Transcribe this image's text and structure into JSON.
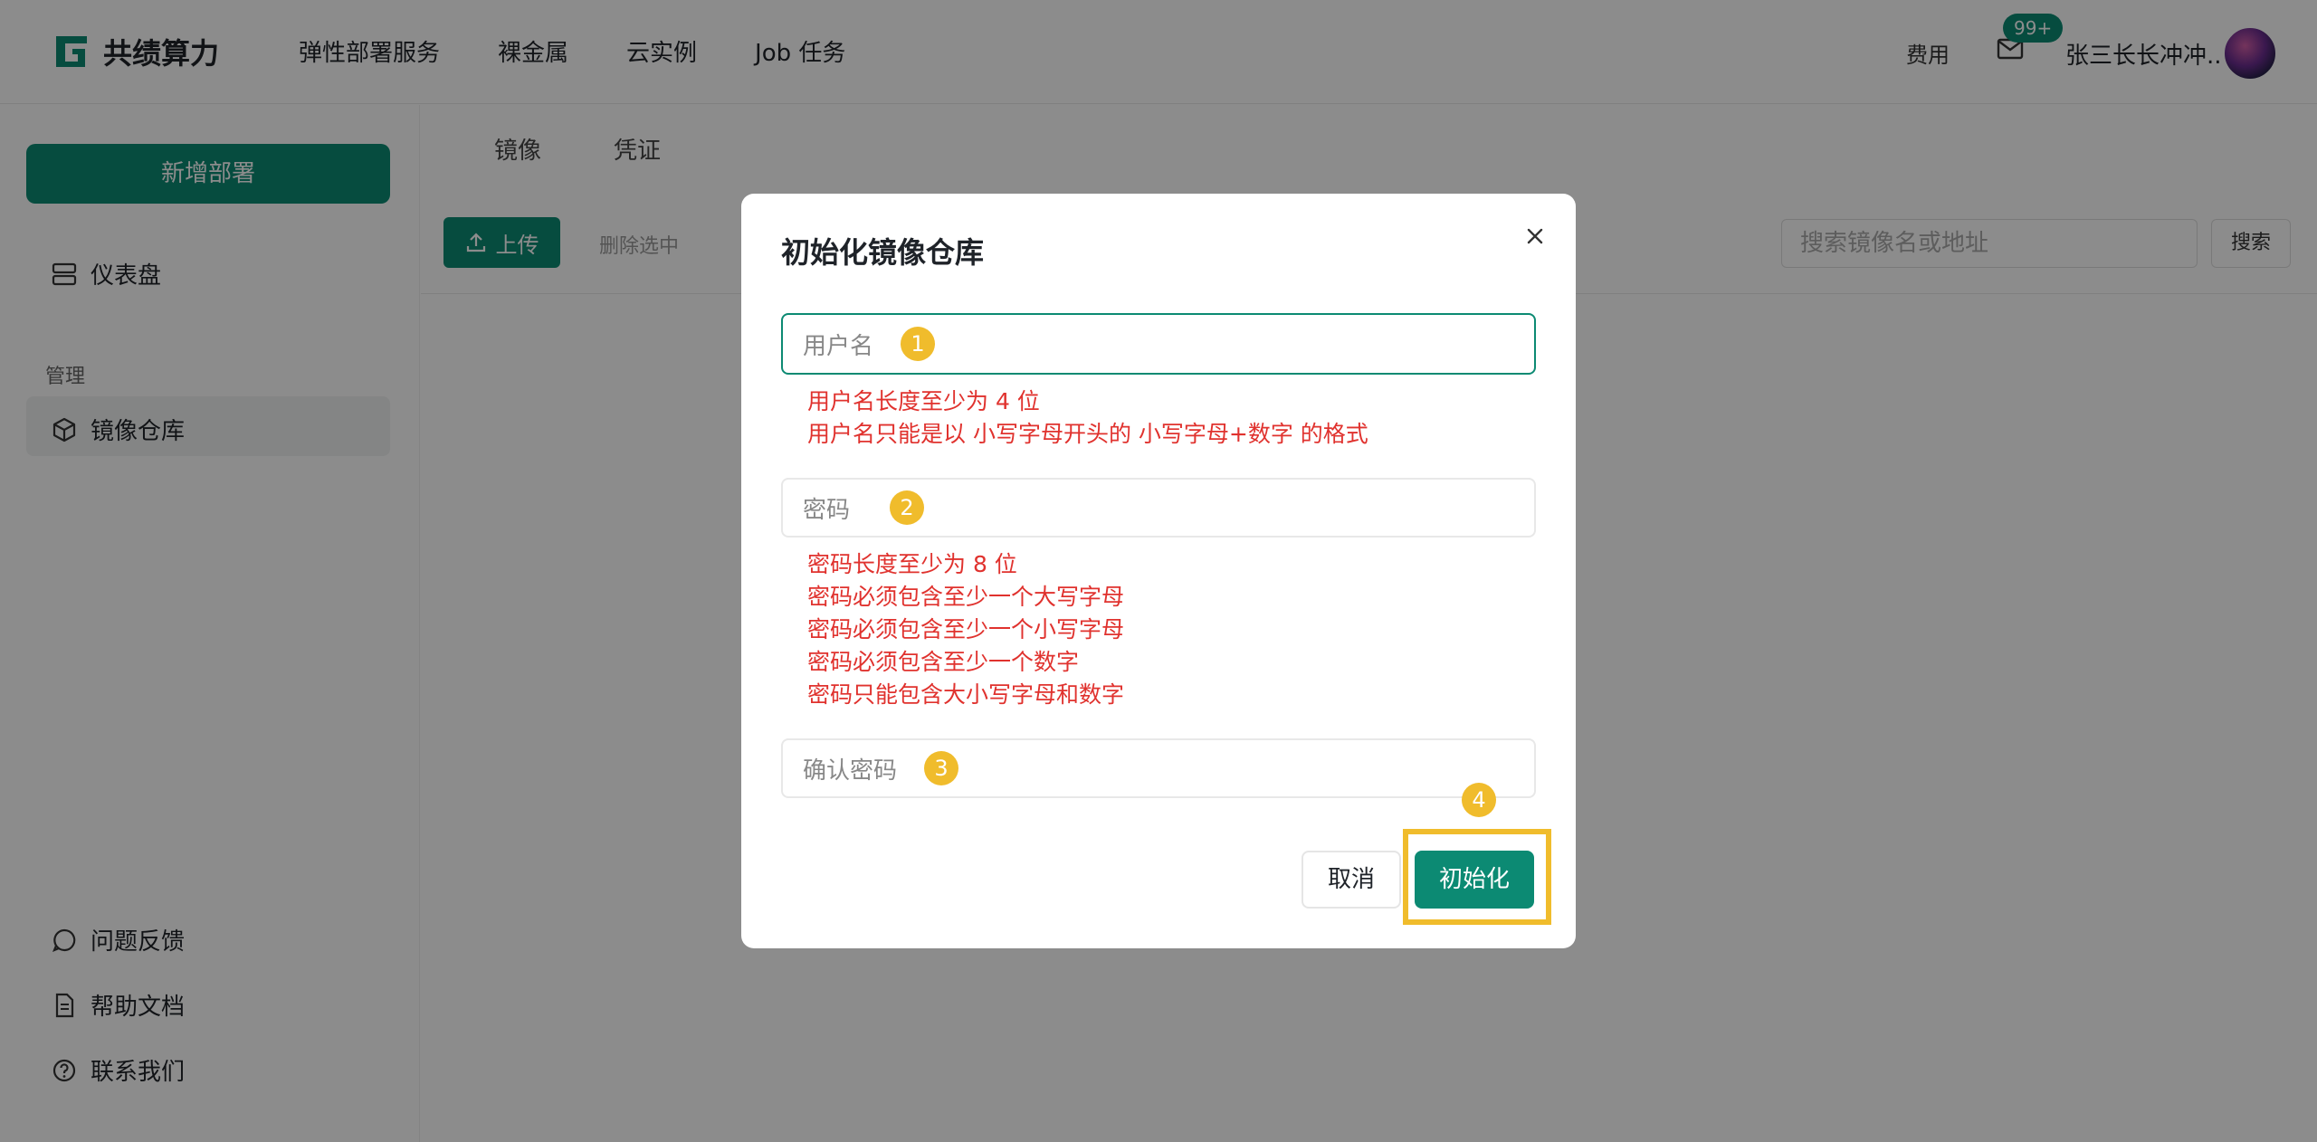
{
  "header": {
    "logo_text": "共绩算力",
    "nav": [
      "弹性部署服务",
      "裸金属",
      "云实例",
      "Job 任务"
    ],
    "fee_label": "费用",
    "mail_badge": "99+",
    "username": "张三长长冲冲.."
  },
  "sidebar": {
    "new_deploy_label": "新增部署",
    "dashboard_label": "仪表盘",
    "section_manage": "管理",
    "registry_label": "镜像仓库",
    "feedback_label": "问题反馈",
    "help_label": "帮助文档",
    "contact_label": "联系我们"
  },
  "main": {
    "tabs": [
      "镜像",
      "凭证"
    ],
    "upload_label": "上传",
    "delete_label": "删除选中",
    "search_placeholder": "搜索镜像名或地址",
    "search_button": "搜索"
  },
  "modal": {
    "title": "初始化镜像仓库",
    "username_placeholder": "用户名",
    "username_errors": [
      "用户名长度至少为 4 位",
      "用户名只能是以 小写字母开头的 小写字母+数字 的格式"
    ],
    "password_placeholder": "密码",
    "password_errors": [
      "密码长度至少为 8 位",
      "密码必须包含至少一个大写字母",
      "密码必须包含至少一个小写字母",
      "密码必须包含至少一个数字",
      "密码只能包含大小写字母和数字"
    ],
    "confirm_placeholder": "确认密码",
    "cancel_label": "取消",
    "init_label": "初始化",
    "markers": [
      "1",
      "2",
      "3",
      "4"
    ]
  },
  "colors": {
    "accent": "#0c8a73",
    "error": "#e0322e",
    "annotation": "#f0bc2c"
  }
}
